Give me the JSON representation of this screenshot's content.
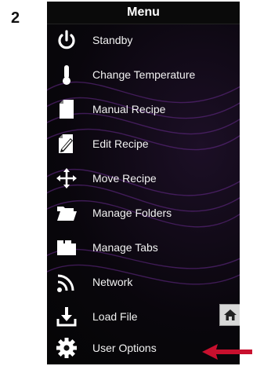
{
  "step_number": "2",
  "menu": {
    "title": "Menu",
    "items": [
      {
        "label": "Standby",
        "icon": "power-icon"
      },
      {
        "label": "Change Temperature",
        "icon": "thermometer-icon"
      },
      {
        "label": "Manual Recipe",
        "icon": "document-icon"
      },
      {
        "label": "Edit Recipe",
        "icon": "edit-recipe-icon"
      },
      {
        "label": "Move Recipe",
        "icon": "move-icon"
      },
      {
        "label": "Manage Folders",
        "icon": "folder-icon"
      },
      {
        "label": "Manage Tabs",
        "icon": "tabs-icon"
      },
      {
        "label": "Network",
        "icon": "network-icon"
      },
      {
        "label": "Load File",
        "icon": "download-icon"
      },
      {
        "label": "User Options",
        "icon": "gear-icon"
      }
    ]
  },
  "home_button": {
    "icon": "home-icon"
  },
  "annotation": {
    "icon": "red-arrow-icon",
    "color": "#c8102e"
  },
  "colors": {
    "panel_bg": "#0a0a0a",
    "accent_swirl": "#6a2c8f",
    "text": "#f2f2f2"
  }
}
